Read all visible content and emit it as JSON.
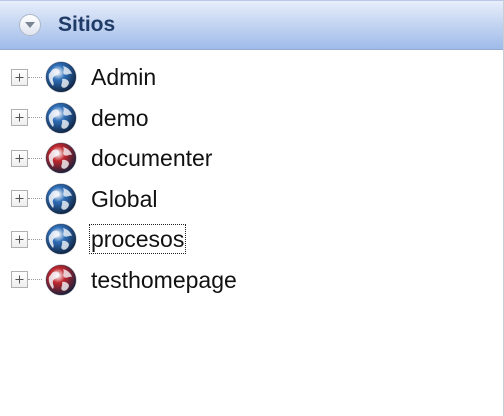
{
  "header": {
    "title": "Sitios",
    "collapse_icon": "chevron-down-icon"
  },
  "colors": {
    "header_text": "#1f3a66",
    "globe_blue": "#2f6fb8",
    "globe_red": "#c0262d"
  },
  "tree": {
    "nodes": [
      {
        "label": "Admin",
        "icon": "globe-icon",
        "color": "blue",
        "focused": false
      },
      {
        "label": "demo",
        "icon": "globe-icon",
        "color": "blue",
        "focused": false
      },
      {
        "label": "documenter",
        "icon": "globe-icon",
        "color": "red",
        "focused": false
      },
      {
        "label": "Global",
        "icon": "globe-icon",
        "color": "blue",
        "focused": false
      },
      {
        "label": "procesos",
        "icon": "globe-icon",
        "color": "blue",
        "focused": true
      },
      {
        "label": "testhomepage",
        "icon": "globe-icon",
        "color": "red",
        "focused": false
      }
    ]
  }
}
